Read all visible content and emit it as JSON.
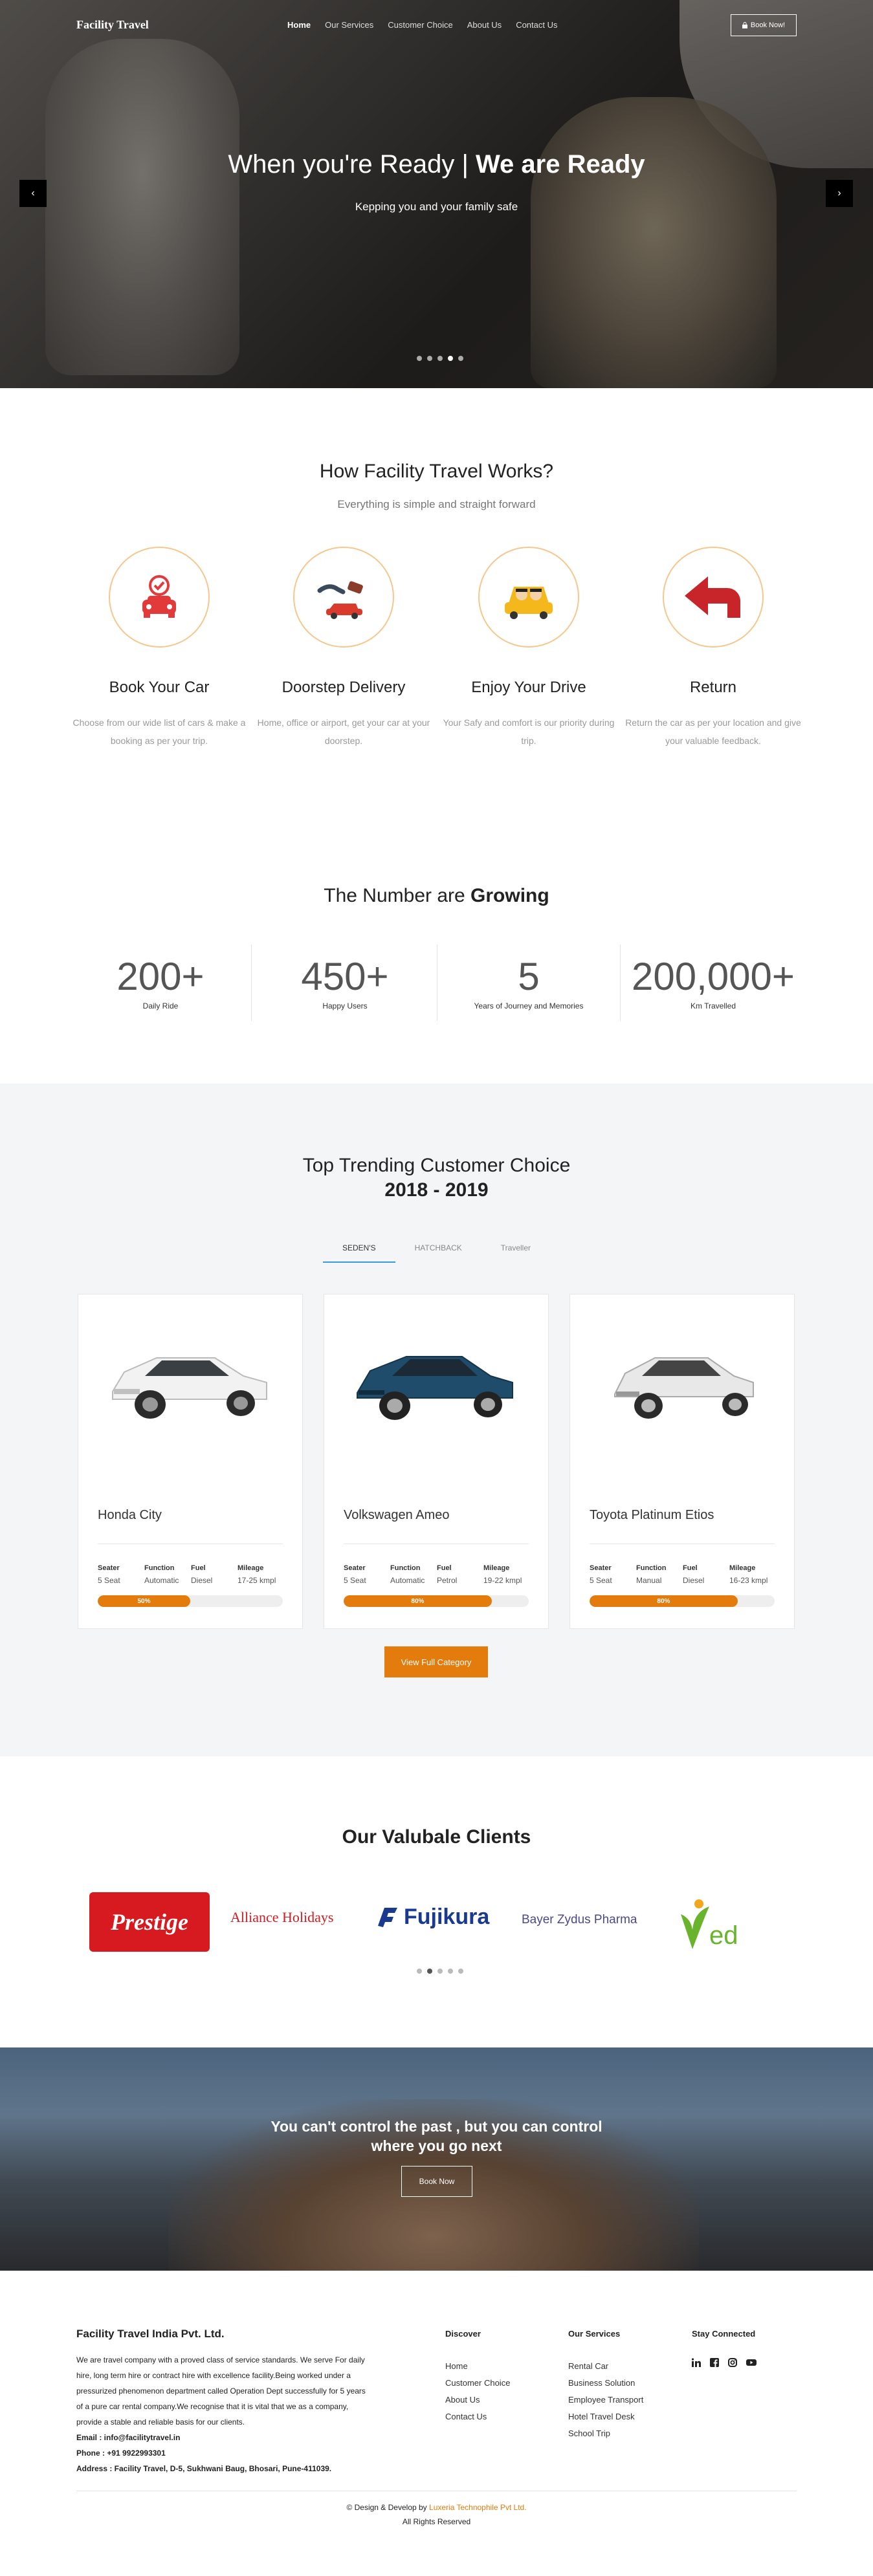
{
  "header": {
    "logo": "Facility Travel",
    "nav": [
      "Home",
      "Our Services",
      "Customer Choice",
      "About Us",
      "Contact Us"
    ],
    "book_button": "Book Now!"
  },
  "hero": {
    "title_light": "When you're Ready | ",
    "title_bold": "We are Ready",
    "subtitle": "Kepping you and your family safe",
    "prev_icon": "‹",
    "next_icon": "›"
  },
  "how": {
    "title": "How Facility Travel Works?",
    "subtitle": "Everything is simple and straight forward",
    "steps": [
      {
        "title": "Book Your Car",
        "text": "Choose from our wide list of cars & make a booking as per your trip."
      },
      {
        "title": "Doorstep Delivery",
        "text": "Home, office or airport, get your car at your doorstep."
      },
      {
        "title": "Enjoy Your Drive",
        "text": "Your Safy and comfort is our priority during trip."
      },
      {
        "title": "Return",
        "text": "Return the car as per your location and give your valuable feedback."
      }
    ]
  },
  "numbers": {
    "title_light": "The Number are ",
    "title_bold": "Growing",
    "items": [
      {
        "value": "200+",
        "label": "Daily Ride"
      },
      {
        "value": "450+",
        "label": "Happy Users"
      },
      {
        "value": "5",
        "label": "Years of Journey and Memories"
      },
      {
        "value": "200,000+",
        "label": "Km Travelled"
      }
    ]
  },
  "trending": {
    "title": "Top Trending Customer Choice",
    "years": "2018 - 2019",
    "tabs": [
      "SEDEN'S",
      "HATCHBACK",
      "Traveller"
    ],
    "spec_labels": [
      "Seater",
      "Function",
      "Fuel",
      "Mileage"
    ],
    "cars": [
      {
        "name": "Honda City",
        "seater": "5 Seat",
        "function": "Automatic",
        "fuel": "Diesel",
        "mileage": "17-25 kmpl",
        "percent_label": "50%",
        "percent": 50,
        "color": "#f2f2f2"
      },
      {
        "name": "Volkswagen Ameo",
        "seater": "5 Seat",
        "function": "Automatic",
        "fuel": "Petrol",
        "mileage": "19-22 kmpl",
        "percent_label": "80%",
        "percent": 80,
        "color": "#1f4c6b"
      },
      {
        "name": "Toyota Platinum Etios",
        "seater": "5 Seat",
        "function": "Manual",
        "fuel": "Diesel",
        "mileage": "16-23 kmpl",
        "percent_label": "80%",
        "percent": 80,
        "color": "#e8e8e8"
      }
    ],
    "view_button": "View Full Category"
  },
  "clients": {
    "title": "Our Valubale Clients",
    "logos": [
      {
        "text": "Prestige",
        "color": "#d71920"
      },
      {
        "text": "Alliance Holidays",
        "color": "#d71920"
      },
      {
        "text": "Fujikura",
        "color": "#1a3a8f"
      },
      {
        "text": "Bayer Zydus Pharma",
        "color": "#4a4a8a"
      },
      {
        "text": "ed",
        "color": "#6ab42d"
      }
    ]
  },
  "banner": {
    "line1": "You can't control the past , but you can control",
    "line2": "where you go next",
    "button": "Book Now"
  },
  "footer": {
    "company": "Facility Travel India Pvt. Ltd.",
    "about": "We are travel company with a proved class of service standards. We serve For daily hire, long term hire or contract hire with excellence facility.Being worked under a pressurized phenomenon department called Operation Dept successfully for 5 years of a pure car rental company.We recognise that it is vital that we as a company, provide a stable and reliable basis for our clients.",
    "email": "Email : info@facilitytravel.in",
    "phone": "Phone : +91 9922993301",
    "address": "Address : Facility Travel, D-5, Sukhwani Baug, Bhosari, Pune-411039.",
    "discover_title": "Discover",
    "discover": [
      "Home",
      "Customer Choice",
      "About Us",
      "Contact Us"
    ],
    "services_title": "Our Services",
    "services": [
      "Rental Car",
      "Business Solution",
      "Employee Transport",
      "Hotel Travel Desk",
      "School Trip"
    ],
    "connected_title": "Stay Connected",
    "social": [
      "linkedin-icon",
      "facebook-icon",
      "instagram-icon",
      "youtube-icon"
    ],
    "credit_prefix": "© Design & Develop by ",
    "credit_link": "Luxeria Technophile Pvt Ltd.",
    "rights": "All Rights Reserved"
  }
}
